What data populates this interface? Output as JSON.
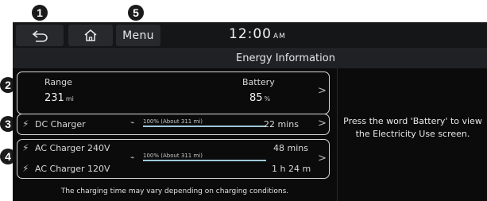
{
  "callouts": {
    "c1": "1",
    "c2": "2",
    "c3": "3",
    "c4": "4",
    "c5": "5"
  },
  "topbar": {
    "menu_label": "Menu",
    "clock_time": "12:00",
    "clock_ampm": "AM"
  },
  "title": "Energy Information",
  "range": {
    "label": "Range",
    "value": "231",
    "unit": "mi"
  },
  "battery": {
    "label": "Battery",
    "value": "85",
    "unit": "%"
  },
  "dc_charger": {
    "label": "DC Charger",
    "bar_text": "100%  (About 311 mi)",
    "time": "22 mins",
    "bar_fraction": 1.0
  },
  "ac_charger": {
    "label_240": "AC Charger 240V",
    "label_120": "AC Charger 120V",
    "bar_text": "100%  (About 311 mi)",
    "time_240": "48 mins",
    "time_120": "1 h  24 m",
    "bar_fraction": 1.0
  },
  "info_text": "Press the word 'Battery' to view the Electricity Use screen.",
  "footnote": "The charging time may vary depending on charging conditions.",
  "colors": {
    "screen_bg": "#0b0b0c",
    "bar_fill": "#9fc8d8",
    "panel_border": "#d8d8d8"
  }
}
